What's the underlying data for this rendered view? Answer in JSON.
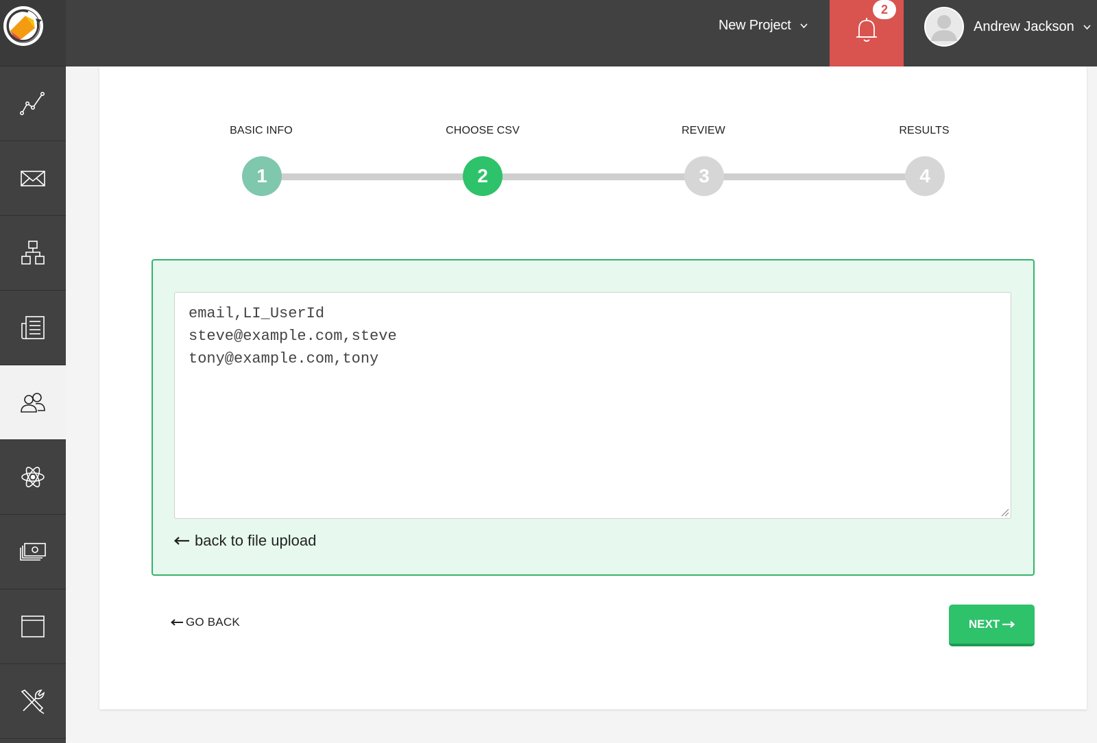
{
  "header": {
    "project_select": "New Project",
    "notifications_count": "2",
    "user_name": "Andrew Jackson"
  },
  "sidebar": {
    "items": [
      {
        "icon": "analytics-chart-icon",
        "active": false
      },
      {
        "icon": "envelope-icon",
        "active": false
      },
      {
        "icon": "hierarchy-icon",
        "active": false
      },
      {
        "icon": "document-list-icon",
        "active": false
      },
      {
        "icon": "users-icon",
        "active": true
      },
      {
        "icon": "atom-icon",
        "active": false
      },
      {
        "icon": "money-icon",
        "active": false
      },
      {
        "icon": "browser-window-icon",
        "active": false
      },
      {
        "icon": "tools-icon",
        "active": false
      }
    ]
  },
  "wizard": {
    "steps": [
      {
        "label": "BASIC INFO",
        "number": "1",
        "state": "completed"
      },
      {
        "label": "CHOOSE CSV",
        "number": "2",
        "state": "current"
      },
      {
        "label": "REVIEW",
        "number": "3",
        "state": "pending"
      },
      {
        "label": "RESULTS",
        "number": "4",
        "state": "pending"
      }
    ],
    "csv_text": "email,LI_UserId\nsteve@example.com,steve\ntony@example.com,tony",
    "back_to_upload": "back to file upload",
    "go_back": "GO BACK",
    "next": "NEXT"
  },
  "colors": {
    "step_completed": "#7fc7ad",
    "step_current": "#2ec26b",
    "step_pending": "#d6d6d6",
    "notification_bg": "#d9534f",
    "panel_bg": "#e7f9ee",
    "panel_border": "#34b36a"
  }
}
